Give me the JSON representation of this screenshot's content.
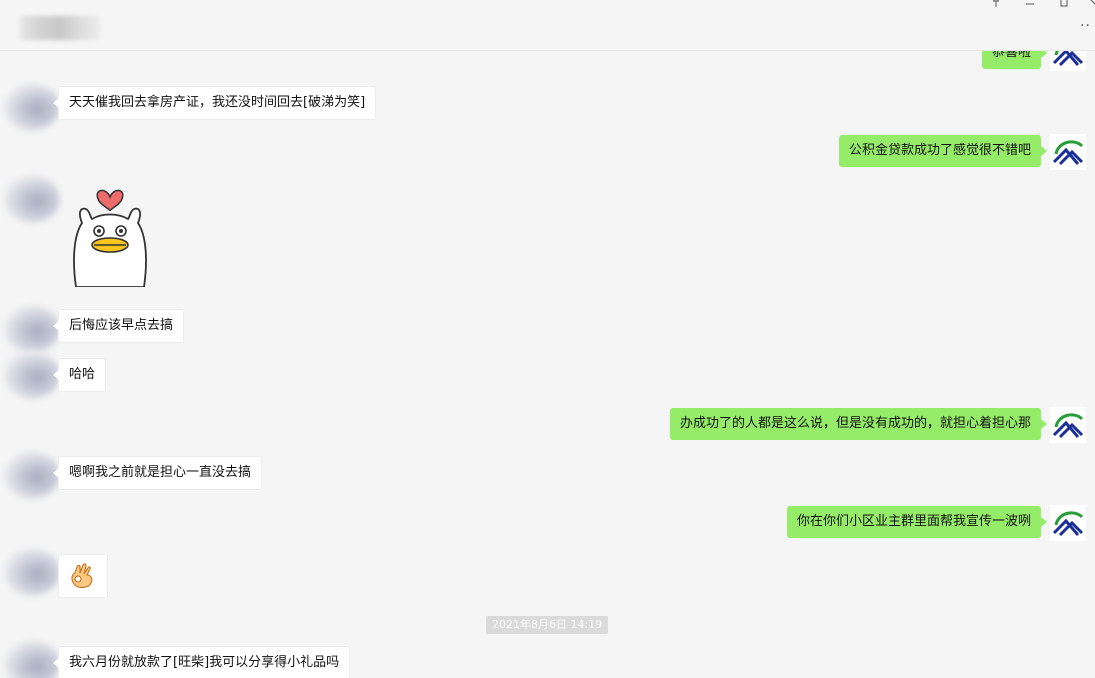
{
  "window": {
    "controls": [
      "pin",
      "minimize",
      "maximize"
    ],
    "more_label": "··"
  },
  "messages": [
    {
      "side": "right",
      "text": "恭喜啦"
    },
    {
      "side": "left",
      "text": "天天催我回去拿房产证，我还没时间回去[破涕为笑]"
    },
    {
      "side": "right",
      "text": "公积金贷款成功了感觉很不错吧"
    },
    {
      "side": "left",
      "type": "sticker",
      "sticker": "duck-with-heart"
    },
    {
      "side": "left",
      "text": "后悔应该早点去搞"
    },
    {
      "side": "left",
      "text": "哈哈"
    },
    {
      "side": "right",
      "text": "办成功了的人都是这么说，但是没有成功的，就担心着担心那"
    },
    {
      "side": "left",
      "text": "嗯啊我之前就是担心一直没去搞"
    },
    {
      "side": "right",
      "text": "你在你们小区业主群里面帮我宣传一波咧"
    },
    {
      "side": "left",
      "type": "emoji",
      "emoji": "ok-hand"
    },
    {
      "side": "left",
      "text": "我六月份就放款了[旺柴]我可以分享得小礼品吗"
    }
  ],
  "timestamp": "2021年8月6日 14:19",
  "colors": {
    "self_bubble": "#95ec69",
    "other_bubble": "#ffffff",
    "background": "#f5f5f5"
  }
}
